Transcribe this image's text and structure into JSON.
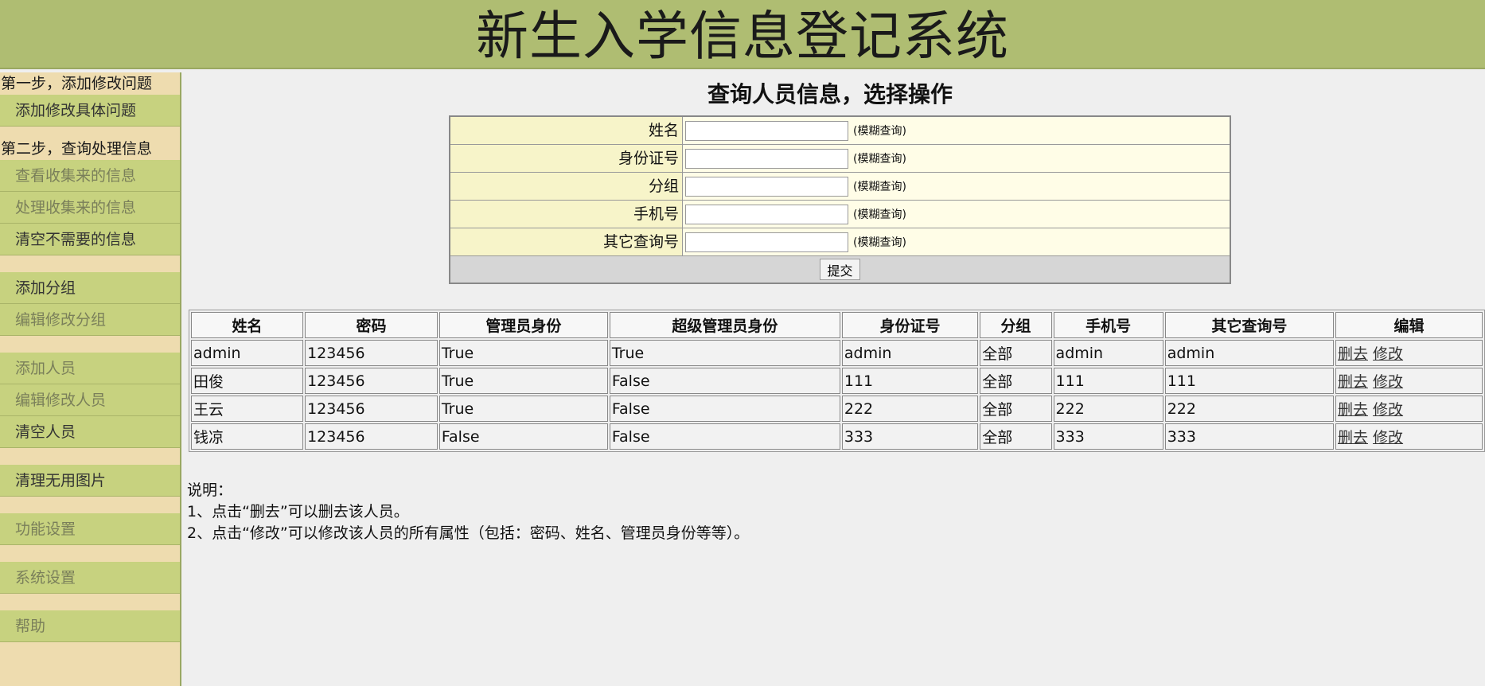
{
  "header": {
    "title": "新生入学信息登记系统"
  },
  "sidebar": {
    "step1": "第一步，添加修改问题",
    "step1_items": [
      "添加修改具体问题"
    ],
    "step2": "第二步，查询处理信息",
    "step2_items": [
      "查看收集来的信息",
      "处理收集来的信息",
      "清空不需要的信息"
    ],
    "group_items": [
      "添加分组",
      "编辑修改分组"
    ],
    "person_items": [
      "添加人员",
      "编辑修改人员",
      "清空人员"
    ],
    "misc_items": [
      "清理无用图片",
      "功能设置",
      "系统设置",
      "帮助"
    ]
  },
  "main": {
    "title": "查询人员信息，选择操作",
    "form": {
      "fields": [
        {
          "label": "姓名",
          "hint": "(模糊查询)",
          "value": ""
        },
        {
          "label": "身份证号",
          "hint": "(模糊查询)",
          "value": ""
        },
        {
          "label": "分组",
          "hint": "(模糊查询)",
          "value": ""
        },
        {
          "label": "手机号",
          "hint": "(模糊查询)",
          "value": ""
        },
        {
          "label": "其它查询号",
          "hint": "(模糊查询)",
          "value": ""
        }
      ],
      "submit": "提交"
    },
    "table": {
      "headers": [
        "姓名",
        "密码",
        "管理员身份",
        "超级管理员身份",
        "身份证号",
        "分组",
        "手机号",
        "其它查询号",
        "编辑"
      ],
      "rows": [
        [
          "admin",
          "123456",
          "True",
          "True",
          "admin",
          "全部",
          "admin",
          "admin"
        ],
        [
          "田俊",
          "123456",
          "True",
          "False",
          "111",
          "全部",
          "111",
          "111"
        ],
        [
          "王云",
          "123456",
          "True",
          "False",
          "222",
          "全部",
          "222",
          "222"
        ],
        [
          "钱凉",
          "123456",
          "False",
          "False",
          "333",
          "全部",
          "333",
          "333"
        ]
      ],
      "delete_label": "删去",
      "edit_label": "修改"
    },
    "notes": {
      "title": "说明：",
      "line1": "1、点击“删去”可以删去该人员。",
      "line2": "2、点击“修改”可以修改该人员的所有属性（包括：密码、姓名、管理员身份等等）。"
    }
  }
}
